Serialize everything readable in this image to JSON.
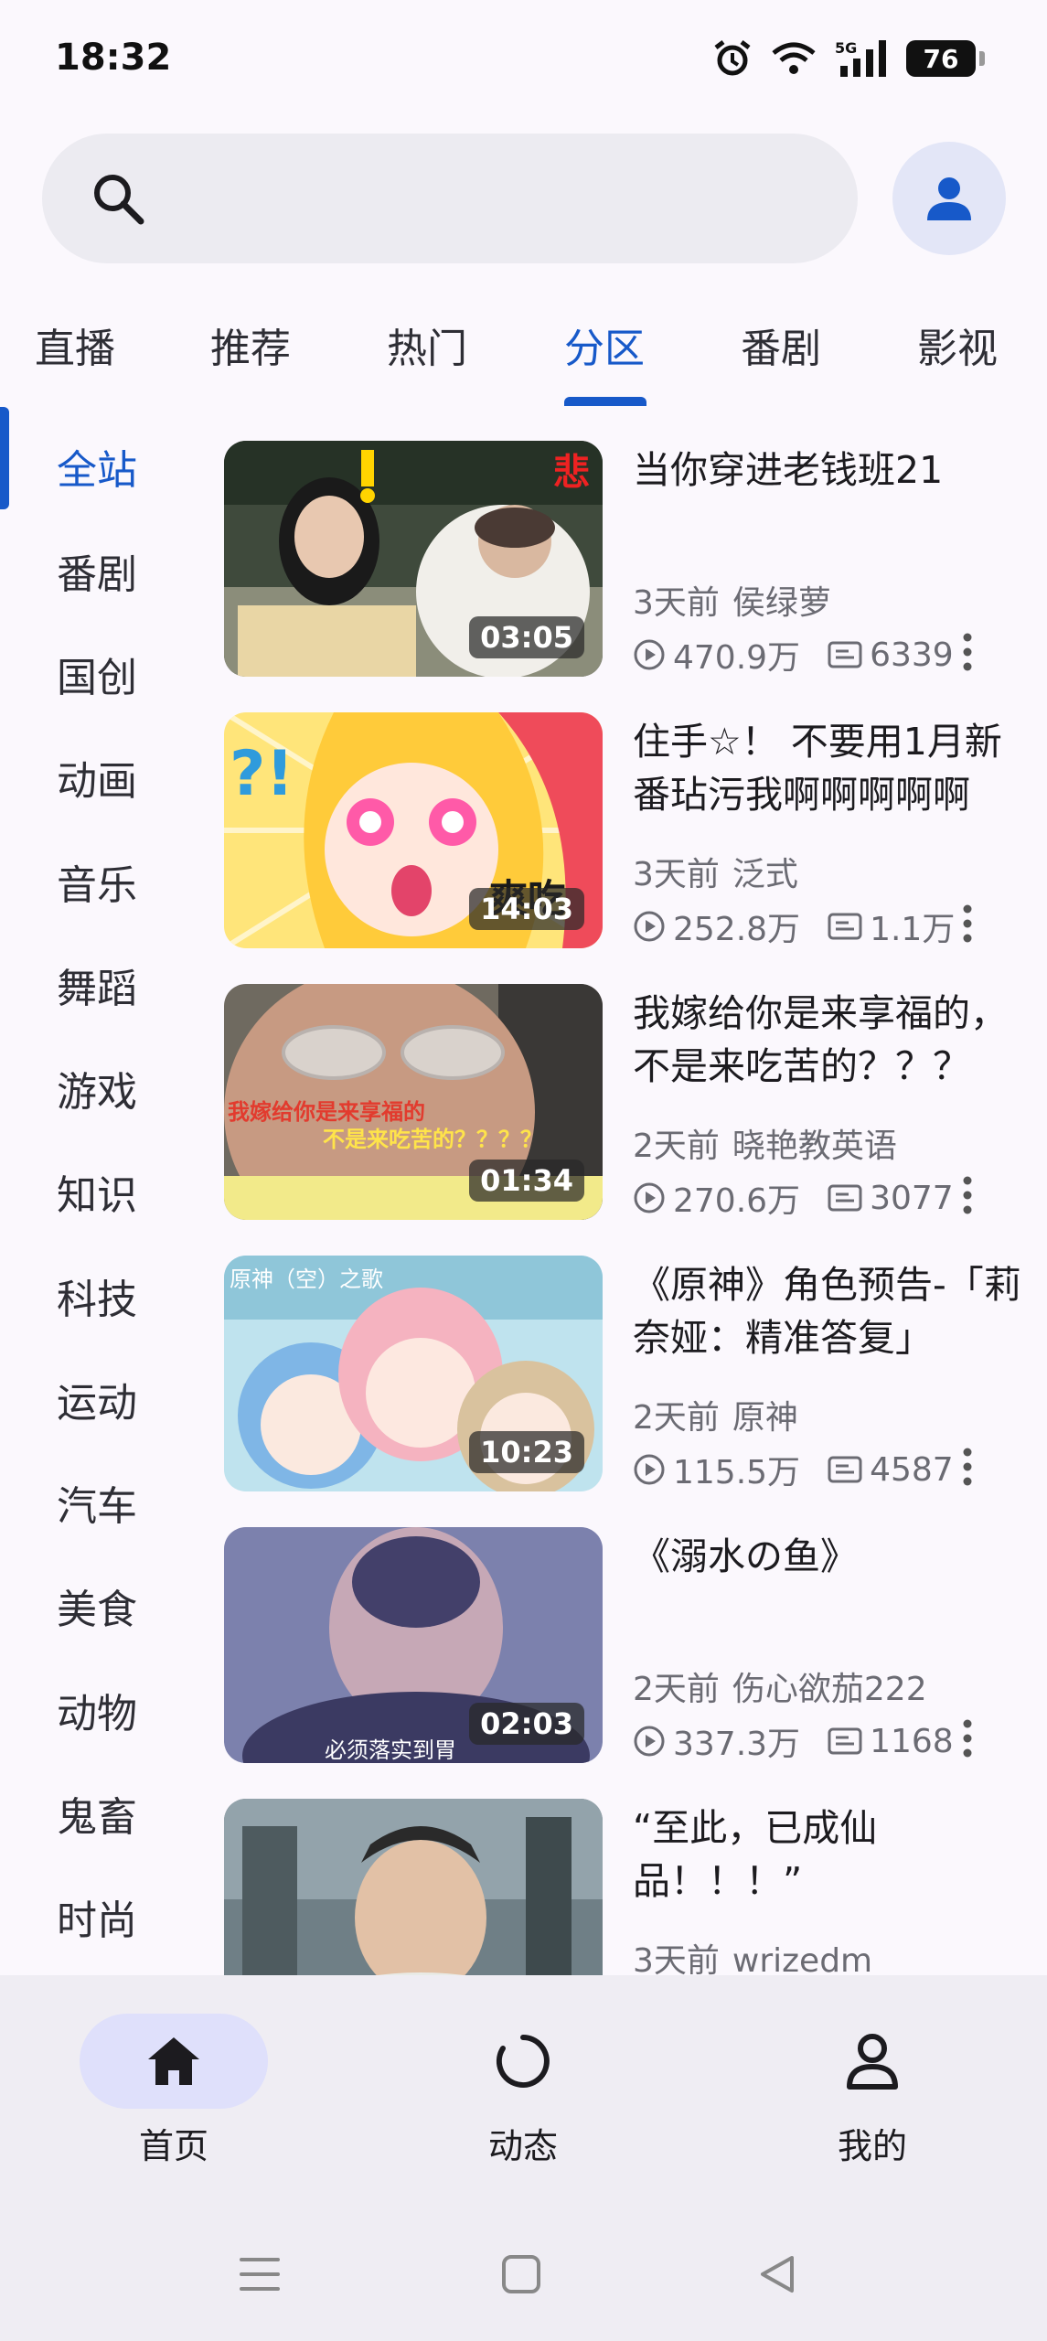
{
  "status_bar": {
    "time": "18:32",
    "battery": "76",
    "network": "5G"
  },
  "search": {
    "placeholder": ""
  },
  "tabs": [
    {
      "label": "直播"
    },
    {
      "label": "推荐"
    },
    {
      "label": "热门"
    },
    {
      "label": "分区",
      "active": true
    },
    {
      "label": "番剧"
    },
    {
      "label": "影视"
    }
  ],
  "categories": [
    "全站",
    "番剧",
    "国创",
    "动画",
    "音乐",
    "舞蹈",
    "游戏",
    "知识",
    "科技",
    "运动",
    "汽车",
    "美食",
    "动物",
    "鬼畜",
    "时尚"
  ],
  "active_category": "全站",
  "videos": [
    {
      "title": "当你穿进老钱班21",
      "duration": "03:05",
      "time": "3天前",
      "uploader": "侯绿萝",
      "views": "470.9万",
      "danmaku": "6339"
    },
    {
      "title": "住手☆！ 不要用1月新番玷污我啊啊啊啊啊",
      "duration": "14:03",
      "time": "3天前",
      "uploader": "泛式",
      "views": "252.8万",
      "danmaku": "1.1万"
    },
    {
      "title": "我嫁给你是来享福的，不是来吃苦的？？？",
      "duration": "01:34",
      "time": "2天前",
      "uploader": "晓艳教英语",
      "views": "270.6万",
      "danmaku": "3077"
    },
    {
      "title": "《原神》角色预告-「莉奈娅：精准答复」",
      "duration": "10:23",
      "time": "2天前",
      "uploader": "原神",
      "views": "115.5万",
      "danmaku": "4587"
    },
    {
      "title": "《溺水の鱼》",
      "duration": "02:03",
      "time": "2天前",
      "uploader": "伤心欲茄222",
      "views": "337.3万",
      "danmaku": "1168"
    },
    {
      "title": "“至此，已成仙品！！！”",
      "duration": "",
      "time": "3天前",
      "uploader": "wrizedm",
      "views": "",
      "danmaku": ""
    }
  ],
  "bottom_nav": [
    {
      "label": "首页",
      "icon": "home-icon",
      "active": true
    },
    {
      "label": "动态",
      "icon": "dynamic-icon"
    },
    {
      "label": "我的",
      "icon": "profile-icon"
    }
  ],
  "colors": {
    "accent": "#1759c9",
    "background": "#fbf8fd",
    "nav_bg": "#efedf3",
    "active_pill": "#dfe0fb"
  }
}
